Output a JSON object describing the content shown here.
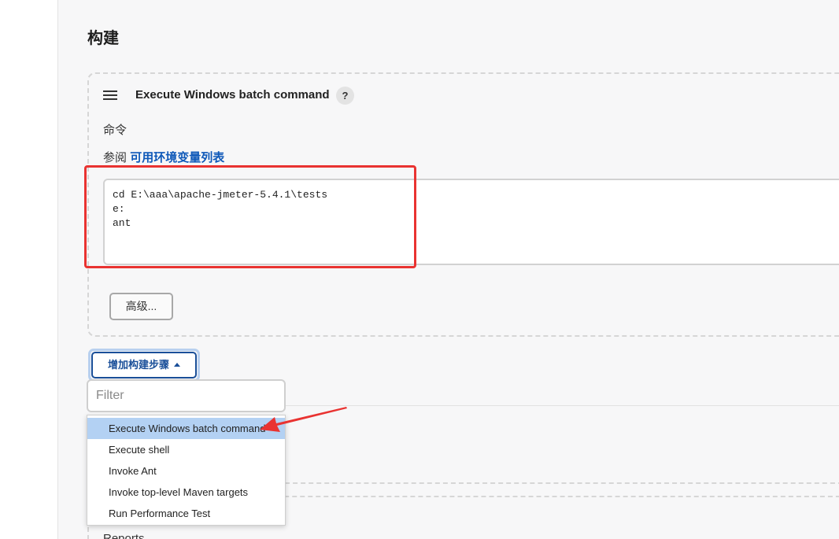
{
  "section": {
    "title": "构建"
  },
  "step": {
    "title": "Execute Windows batch command",
    "help_label": "?",
    "command_label": "命令",
    "env_prefix": "参阅",
    "env_link": "可用环境变量列表",
    "command_value": "cd E:\\aaa\\apache-jmeter-5.4.1\\tests\ne:\nant",
    "advanced_label": "高级..."
  },
  "add_step": {
    "label": "增加构建步骤"
  },
  "filter": {
    "placeholder": "Filter",
    "value": ""
  },
  "dropdown": {
    "items": [
      {
        "label": "Execute Windows batch command"
      },
      {
        "label": "Execute shell"
      },
      {
        "label": "Invoke Ant"
      },
      {
        "label": "Invoke top-level Maven targets"
      },
      {
        "label": "Run Performance Test"
      }
    ]
  },
  "reports": {
    "label": "Reports"
  },
  "colors": {
    "highlight": "#e93331",
    "link": "#0e58b8",
    "selected": "#b3d1f3"
  },
  "icons": {
    "drag": "drag-handle-icon",
    "help": "help-icon",
    "caret": "caret-up-icon"
  }
}
